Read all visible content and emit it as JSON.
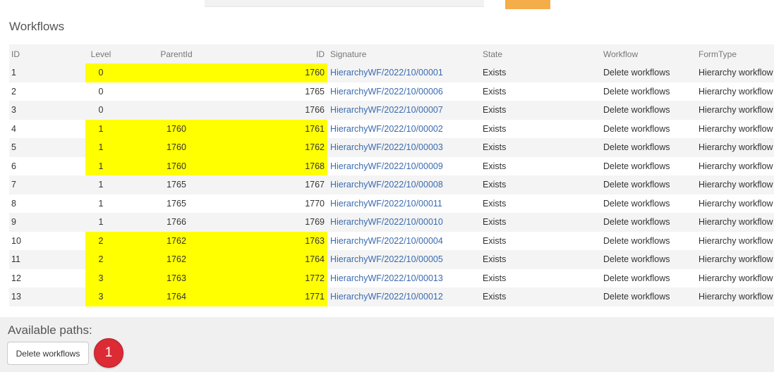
{
  "section_title": "Workflows",
  "columns": {
    "idx": "ID",
    "level": "Level",
    "parent": "ParentId",
    "id": "ID",
    "signature": "Signature",
    "state": "State",
    "workflow": "Workflow",
    "form_type": "FormType"
  },
  "rows": [
    {
      "idx": "1",
      "level": "0",
      "parent": "",
      "id": "1760",
      "signature": "HierarchyWF/2022/10/00001",
      "state": "Exists",
      "workflow": "Delete workflows",
      "form_type": "Hierarchy workflow",
      "highlighted": true
    },
    {
      "idx": "2",
      "level": "0",
      "parent": "",
      "id": "1765",
      "signature": "HierarchyWF/2022/10/00006",
      "state": "Exists",
      "workflow": "Delete workflows",
      "form_type": "Hierarchy workflow",
      "highlighted": false
    },
    {
      "idx": "3",
      "level": "0",
      "parent": "",
      "id": "1766",
      "signature": "HierarchyWF/2022/10/00007",
      "state": "Exists",
      "workflow": "Delete workflows",
      "form_type": "Hierarchy workflow",
      "highlighted": false
    },
    {
      "idx": "4",
      "level": "1",
      "parent": "1760",
      "id": "1761",
      "signature": "HierarchyWF/2022/10/00002",
      "state": "Exists",
      "workflow": "Delete workflows",
      "form_type": "Hierarchy workflow",
      "highlighted": true
    },
    {
      "idx": "5",
      "level": "1",
      "parent": "1760",
      "id": "1762",
      "signature": "HierarchyWF/2022/10/00003",
      "state": "Exists",
      "workflow": "Delete workflows",
      "form_type": "Hierarchy workflow",
      "highlighted": true
    },
    {
      "idx": "6",
      "level": "1",
      "parent": "1760",
      "id": "1768",
      "signature": "HierarchyWF/2022/10/00009",
      "state": "Exists",
      "workflow": "Delete workflows",
      "form_type": "Hierarchy workflow",
      "highlighted": true
    },
    {
      "idx": "7",
      "level": "1",
      "parent": "1765",
      "id": "1767",
      "signature": "HierarchyWF/2022/10/00008",
      "state": "Exists",
      "workflow": "Delete workflows",
      "form_type": "Hierarchy workflow",
      "highlighted": false
    },
    {
      "idx": "8",
      "level": "1",
      "parent": "1765",
      "id": "1770",
      "signature": "HierarchyWF/2022/10/00011",
      "state": "Exists",
      "workflow": "Delete workflows",
      "form_type": "Hierarchy workflow",
      "highlighted": false
    },
    {
      "idx": "9",
      "level": "1",
      "parent": "1766",
      "id": "1769",
      "signature": "HierarchyWF/2022/10/00010",
      "state": "Exists",
      "workflow": "Delete workflows",
      "form_type": "Hierarchy workflow",
      "highlighted": false
    },
    {
      "idx": "10",
      "level": "2",
      "parent": "1762",
      "id": "1763",
      "signature": "HierarchyWF/2022/10/00004",
      "state": "Exists",
      "workflow": "Delete workflows",
      "form_type": "Hierarchy workflow",
      "highlighted": true
    },
    {
      "idx": "11",
      "level": "2",
      "parent": "1762",
      "id": "1764",
      "signature": "HierarchyWF/2022/10/00005",
      "state": "Exists",
      "workflow": "Delete workflows",
      "form_type": "Hierarchy workflow",
      "highlighted": true
    },
    {
      "idx": "12",
      "level": "3",
      "parent": "1763",
      "id": "1772",
      "signature": "HierarchyWF/2022/10/00013",
      "state": "Exists",
      "workflow": "Delete workflows",
      "form_type": "Hierarchy workflow",
      "highlighted": true
    },
    {
      "idx": "13",
      "level": "3",
      "parent": "1764",
      "id": "1771",
      "signature": "HierarchyWF/2022/10/00012",
      "state": "Exists",
      "workflow": "Delete workflows",
      "form_type": "Hierarchy workflow",
      "highlighted": true
    }
  ],
  "footer": {
    "paths_label": "Available paths:",
    "delete_button_label": "Delete workflows",
    "badge_number": "1"
  },
  "colors": {
    "highlight": "#ffff00",
    "link": "#3a6bb0",
    "badge": "#dc2b35",
    "accent_orange": "#f5ad49"
  }
}
